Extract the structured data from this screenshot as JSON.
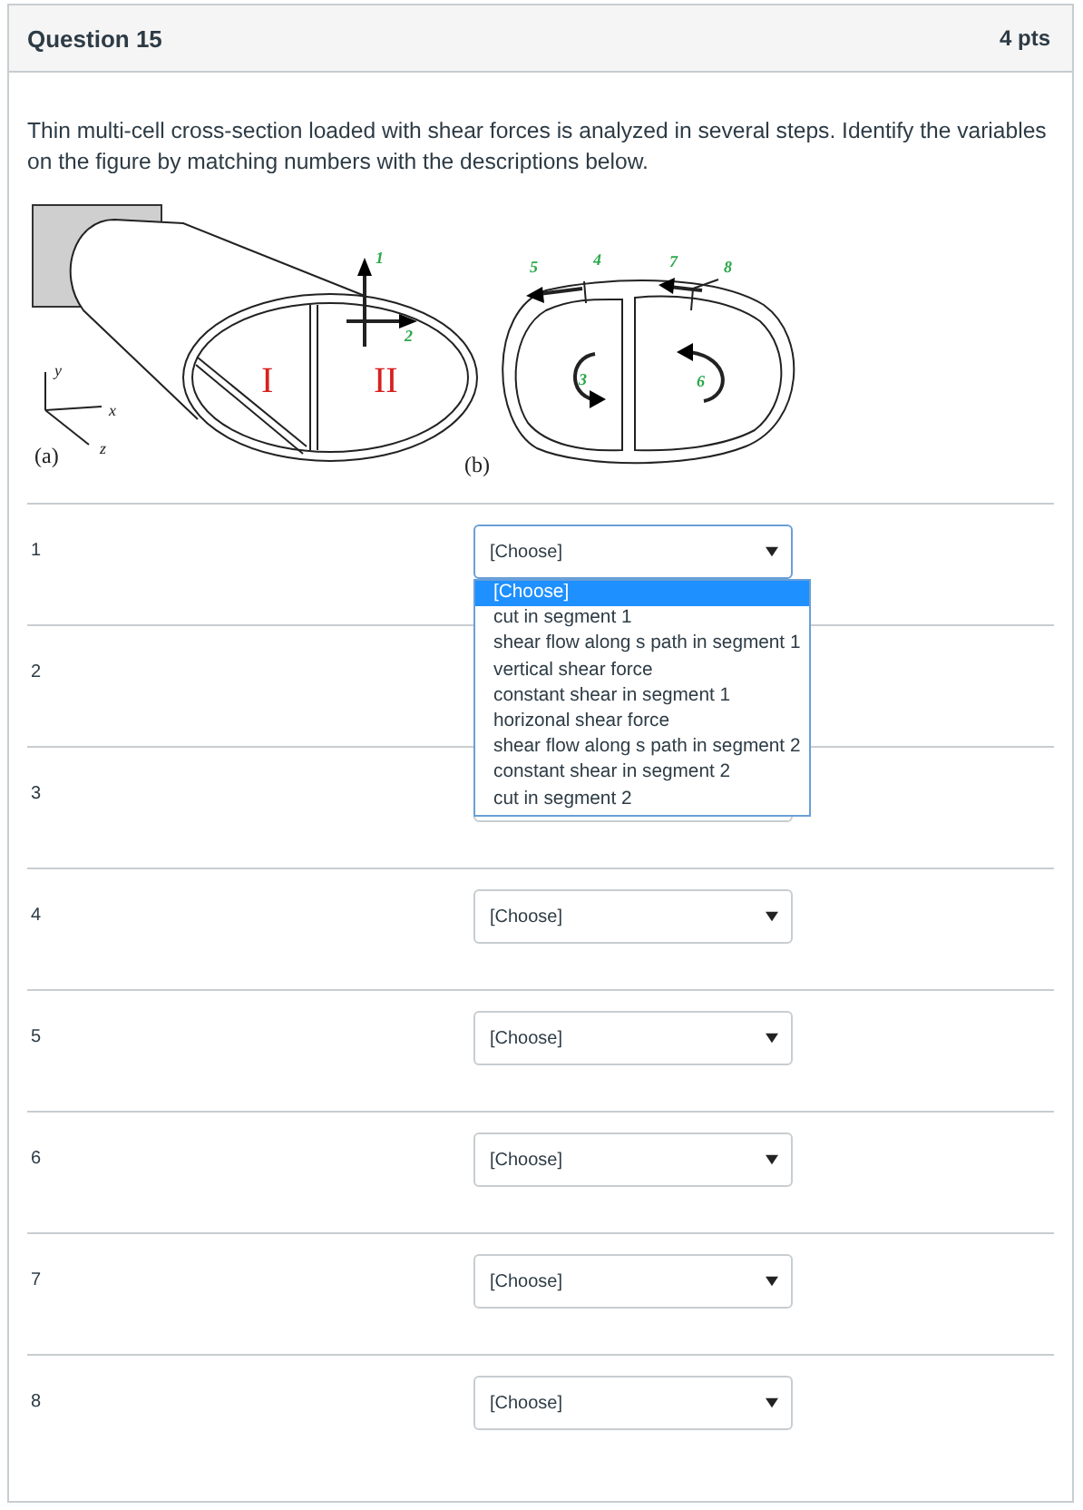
{
  "question": {
    "title": "Question 15",
    "points": "4 pts"
  },
  "prompt": "Thin multi-cell cross-section loaded with shear forces is analyzed in several steps. Identify the variables on the figure by matching numbers with the descriptions below.",
  "figure_labels": [
    {
      "text": "1",
      "kind": "variable"
    },
    {
      "text": "2",
      "kind": "variable"
    },
    {
      "text": "y",
      "kind": "axis"
    },
    {
      "text": "I",
      "kind": "cell"
    },
    {
      "text": "II",
      "kind": "cell"
    },
    {
      "text": "x",
      "kind": "axis"
    },
    {
      "text": "(a)",
      "kind": "panel"
    },
    {
      "text": "z",
      "kind": "axis"
    },
    {
      "text": "4",
      "kind": "variable"
    },
    {
      "text": "7",
      "kind": "variable"
    },
    {
      "text": "5",
      "kind": "variable"
    },
    {
      "text": "8",
      "kind": "variable"
    },
    {
      "text": "3",
      "kind": "variable"
    },
    {
      "text": "6",
      "kind": "variable"
    },
    {
      "text": "(b)",
      "kind": "panel"
    }
  ],
  "rows": [
    {
      "number": "1",
      "value": "[Choose]",
      "open": true
    },
    {
      "number": "2"
    },
    {
      "number": "3",
      "open": false
    },
    {
      "number": "4",
      "value": "[Choose]",
      "open": false
    },
    {
      "number": "5",
      "value": "[Choose]",
      "open": false
    },
    {
      "number": "6",
      "value": "[Choose]",
      "open": false
    },
    {
      "number": "7",
      "value": "[Choose]",
      "open": false
    },
    {
      "number": "8",
      "value": "[Choose]",
      "open": false
    }
  ],
  "options": [
    {
      "label": "[Choose]",
      "selected": true
    },
    {
      "label": "cut in segment 1",
      "selected": false
    },
    {
      "label": "shear flow along s path in segment 1",
      "selected": false
    },
    {
      "label": "vertical shear force",
      "selected": false
    },
    {
      "label": "constant shear in segment 1",
      "selected": false
    },
    {
      "label": "horizonal shear force",
      "selected": false
    },
    {
      "label": "shear flow along s path in segment 2",
      "selected": false
    },
    {
      "label": "constant shear in segment 2",
      "selected": false
    },
    {
      "label": "cut in segment 2",
      "selected": false
    }
  ]
}
